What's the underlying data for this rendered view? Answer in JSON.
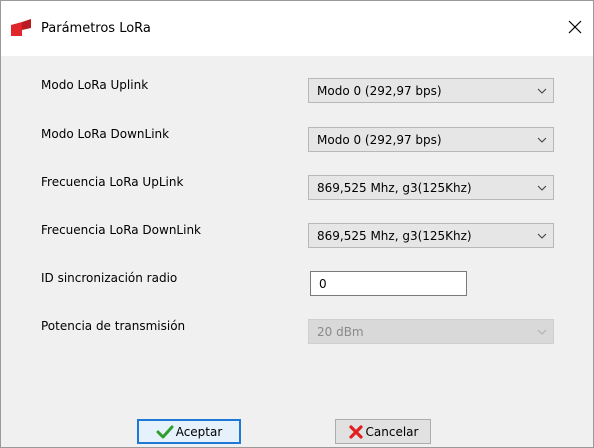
{
  "window": {
    "title": "Parámetros LoRa",
    "icon": "app-logo-icon",
    "close_icon": "close-icon"
  },
  "fields": [
    {
      "label": "Modo LoRa Uplink",
      "type": "dropdown",
      "value": "Modo 0 (292,97 bps)",
      "enabled": true
    },
    {
      "label": "Modo LoRa DownLink",
      "type": "dropdown",
      "value": "Modo 0 (292,97 bps)",
      "enabled": true
    },
    {
      "label": "Frecuencia LoRa UpLink",
      "type": "dropdown",
      "value": "869,525 Mhz, g3(125Khz)",
      "enabled": true
    },
    {
      "label": "Frecuencia LoRa DownLink",
      "type": "dropdown",
      "value": "869,525 Mhz, g3(125Khz)",
      "enabled": true
    },
    {
      "label": "ID sincronización radio",
      "type": "text",
      "value": "0",
      "enabled": true
    },
    {
      "label": "Potencia de transmisión",
      "type": "dropdown",
      "value": "20 dBm",
      "enabled": false
    }
  ],
  "buttons": {
    "accept": {
      "label": "Aceptar",
      "icon": "checkmark-icon",
      "accent": "#2e9e2e"
    },
    "cancel": {
      "label": "Cancelar",
      "icon": "red-x-icon",
      "accent": "#e02020"
    }
  },
  "colors": {
    "brand": "#e0262b",
    "focus_border": "#1e78d6"
  }
}
